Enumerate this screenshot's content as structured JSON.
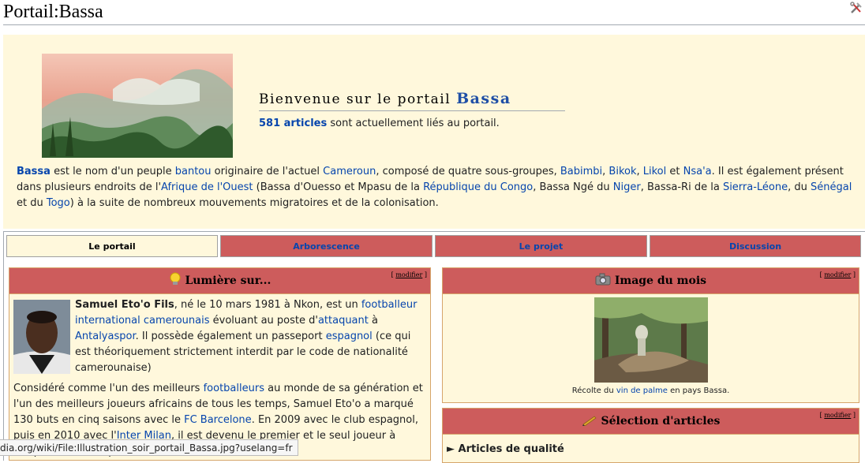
{
  "page": {
    "title": "Portail:Bassa",
    "tools_icon": "tools-icon"
  },
  "intro": {
    "welcome_prefix": "Bienvenue sur le portail",
    "welcome_name": "Bassa",
    "count_link": "581 articles",
    "count_rest": " sont actuellement liés au portail.",
    "desc": [
      {
        "t": "Bassa",
        "l": true,
        "b": true
      },
      {
        "t": " est le nom d'un peuple "
      },
      {
        "t": "bantou",
        "l": true
      },
      {
        "t": " originaire de l'actuel "
      },
      {
        "t": "Cameroun",
        "l": true
      },
      {
        "t": ", composé de quatre sous-groupes, "
      },
      {
        "t": "Babimbi",
        "l": true
      },
      {
        "t": ", "
      },
      {
        "t": "Bikok",
        "l": true
      },
      {
        "t": ", "
      },
      {
        "t": "Likol",
        "l": true
      },
      {
        "t": " et "
      },
      {
        "t": "Nsa'a",
        "l": true
      },
      {
        "t": ". Il est également présent dans plusieurs endroits de l'"
      },
      {
        "t": "Afrique de l'Ouest",
        "l": true
      },
      {
        "t": " (Bassa d'Ouesso et Mpasu de la "
      },
      {
        "t": "République du Congo",
        "l": true
      },
      {
        "t": ", Bassa Ngé du "
      },
      {
        "t": "Niger",
        "l": true
      },
      {
        "t": ", Bassa-Ri de la "
      },
      {
        "t": "Sierra-Léone",
        "l": true
      },
      {
        "t": ", du "
      },
      {
        "t": "Sénégal",
        "l": true
      },
      {
        "t": " et du "
      },
      {
        "t": "Togo",
        "l": true
      },
      {
        "t": ") à la suite de nombreux mouvements migratoires et de la colonisation."
      }
    ]
  },
  "tabs": [
    {
      "label": "Le portail",
      "active": true
    },
    {
      "label": "Arborescence",
      "active": false
    },
    {
      "label": "Le projet",
      "active": false
    },
    {
      "label": "Discussion",
      "active": false
    }
  ],
  "lumiere": {
    "title": "Lumière sur...",
    "modifier": "modifier",
    "p1": [
      {
        "t": "Samuel Eto'o Fils",
        "b": true
      },
      {
        "t": ", né le 10 mars 1981 à Nkon, est un "
      },
      {
        "t": "footballeur international camerounais",
        "l": true
      },
      {
        "t": " évoluant au poste d'"
      },
      {
        "t": "attaquant",
        "l": true
      },
      {
        "t": " à "
      },
      {
        "t": "Antalyaspor",
        "l": true
      },
      {
        "t": ". Il possède également un passeport "
      },
      {
        "t": "espagnol",
        "l": true
      },
      {
        "t": " (ce qui est théoriquement strictement interdit par le code de nationalité camerounaise)"
      }
    ],
    "p2": [
      {
        "t": "Considéré comme l'un des meilleurs "
      },
      {
        "t": "footballeurs",
        "l": true
      },
      {
        "t": " au monde de sa génération et l'un des meilleurs joueurs africains de tous les temps, Samuel Eto'o a marqué 130 buts en cinq saisons avec le "
      },
      {
        "t": "FC Barcelone",
        "l": true
      },
      {
        "t": ". En 2009 avec le club espagnol, puis en 2010 avec l'"
      },
      {
        "t": "Inter Milan",
        "l": true
      },
      {
        "t": ", il est devenu le premier et le seul joueur à remporter deux triplés consécutifs, il est le seul"
      }
    ]
  },
  "image_mois": {
    "title": "Image du mois",
    "modifier": "modifier",
    "caption": [
      {
        "t": "Récolte du "
      },
      {
        "t": "vin de palme",
        "l": true
      },
      {
        "t": " en pays Bassa."
      }
    ]
  },
  "selection": {
    "title": "Sélection d'articles",
    "modifier": "modifier",
    "subheading": "► Articles de qualité"
  },
  "status_url": "dia.org/wiki/File:Illustration_soir_portail_Bassa.jpg?uselang=fr"
}
